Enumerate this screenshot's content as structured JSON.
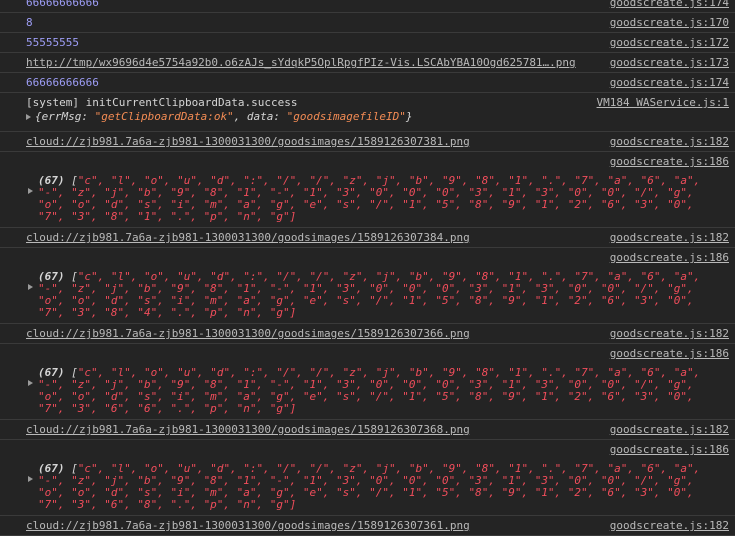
{
  "rows": [
    {
      "msg": "66666666666",
      "src": "goodscreate.js:174"
    },
    {
      "msg": "8",
      "src": "goodscreate.js:170"
    },
    {
      "msg": "55555555",
      "src": "goodscreate.js:172"
    },
    {
      "msg": "http://tmp/wx9696d4e5754a92b0.o6zAJs_sYdqkP5OplRpgfPIz-Vis.LSCAbYBA10Ogd625781….png",
      "src": "goodscreate.js:173"
    },
    {
      "msg": "66666666666",
      "src": "goodscreate.js:174"
    }
  ],
  "system": {
    "msg": "[system] initCurrentClipboardData.success",
    "src": "VM184 WAService.js:1",
    "obj_open": "{errMsg: ",
    "obj_val1": "\"getClipboardData:ok\"",
    "obj_mid": ", data: ",
    "obj_val2": "\"goodsimagefileID\"",
    "obj_close": "}"
  },
  "groups": [
    {
      "url": "cloud://zjb981.7a6a-zjb981-1300031300/goodsimages/1589126307381.png",
      "src": "goodscreate.js:182",
      "arr_src": "goodscreate.js:186",
      "count": "(67)",
      "line1": "\"c\", \"l\", \"o\", \"u\", \"d\", \":\", \"/\", \"/\", \"z\", \"j\", \"b\", \"9\", \"8\", \"1\", \".\", \"7\", \"a\", \"6\", \"a\",",
      "line2": "\"-\", \"z\", \"j\", \"b\", \"9\", \"8\", \"1\", \"-\", \"1\", \"3\", \"0\", \"0\", \"0\", \"3\", \"1\", \"3\", \"0\", \"0\", \"/\", \"g\",",
      "line3": "\"o\", \"o\", \"d\", \"s\", \"i\", \"m\", \"a\", \"g\", \"e\", \"s\", \"/\", \"1\", \"5\", \"8\", \"9\", \"1\", \"2\", \"6\", \"3\", \"0\",",
      "line4": "\"7\", \"3\", \"8\", \"1\", \".\", \"p\", \"n\", \"g\"]"
    },
    {
      "url": "cloud://zjb981.7a6a-zjb981-1300031300/goodsimages/1589126307384.png",
      "src": "goodscreate.js:182",
      "arr_src": "goodscreate.js:186",
      "count": "(67)",
      "line1": "\"c\", \"l\", \"o\", \"u\", \"d\", \":\", \"/\", \"/\", \"z\", \"j\", \"b\", \"9\", \"8\", \"1\", \".\", \"7\", \"a\", \"6\", \"a\",",
      "line2": "\"-\", \"z\", \"j\", \"b\", \"9\", \"8\", \"1\", \"-\", \"1\", \"3\", \"0\", \"0\", \"0\", \"3\", \"1\", \"3\", \"0\", \"0\", \"/\", \"g\",",
      "line3": "\"o\", \"o\", \"d\", \"s\", \"i\", \"m\", \"a\", \"g\", \"e\", \"s\", \"/\", \"1\", \"5\", \"8\", \"9\", \"1\", \"2\", \"6\", \"3\", \"0\",",
      "line4": "\"7\", \"3\", \"8\", \"4\", \".\", \"p\", \"n\", \"g\"]"
    },
    {
      "url": "cloud://zjb981.7a6a-zjb981-1300031300/goodsimages/1589126307366.png",
      "src": "goodscreate.js:182",
      "arr_src": "goodscreate.js:186",
      "count": "(67)",
      "line1": "\"c\", \"l\", \"o\", \"u\", \"d\", \":\", \"/\", \"/\", \"z\", \"j\", \"b\", \"9\", \"8\", \"1\", \".\", \"7\", \"a\", \"6\", \"a\",",
      "line2": "\"-\", \"z\", \"j\", \"b\", \"9\", \"8\", \"1\", \"-\", \"1\", \"3\", \"0\", \"0\", \"0\", \"3\", \"1\", \"3\", \"0\", \"0\", \"/\", \"g\",",
      "line3": "\"o\", \"o\", \"d\", \"s\", \"i\", \"m\", \"a\", \"g\", \"e\", \"s\", \"/\", \"1\", \"5\", \"8\", \"9\", \"1\", \"2\", \"6\", \"3\", \"0\",",
      "line4": "\"7\", \"3\", \"6\", \"6\", \".\", \"p\", \"n\", \"g\"]"
    },
    {
      "url": "cloud://zjb981.7a6a-zjb981-1300031300/goodsimages/1589126307368.png",
      "src": "goodscreate.js:182",
      "arr_src": "goodscreate.js:186",
      "count": "(67)",
      "line1": "\"c\", \"l\", \"o\", \"u\", \"d\", \":\", \"/\", \"/\", \"z\", \"j\", \"b\", \"9\", \"8\", \"1\", \".\", \"7\", \"a\", \"6\", \"a\",",
      "line2": "\"-\", \"z\", \"j\", \"b\", \"9\", \"8\", \"1\", \"-\", \"1\", \"3\", \"0\", \"0\", \"0\", \"3\", \"1\", \"3\", \"0\", \"0\", \"/\", \"g\",",
      "line3": "\"o\", \"o\", \"d\", \"s\", \"i\", \"m\", \"a\", \"g\", \"e\", \"s\", \"/\", \"1\", \"5\", \"8\", \"9\", \"1\", \"2\", \"6\", \"3\", \"0\",",
      "line4": "\"7\", \"3\", \"6\", \"8\", \".\", \"p\", \"n\", \"g\"]"
    }
  ],
  "last": {
    "url": "cloud://zjb981.7a6a-zjb981-1300031300/goodsimages/1589126307361.png",
    "src": "goodscreate.js:182"
  }
}
